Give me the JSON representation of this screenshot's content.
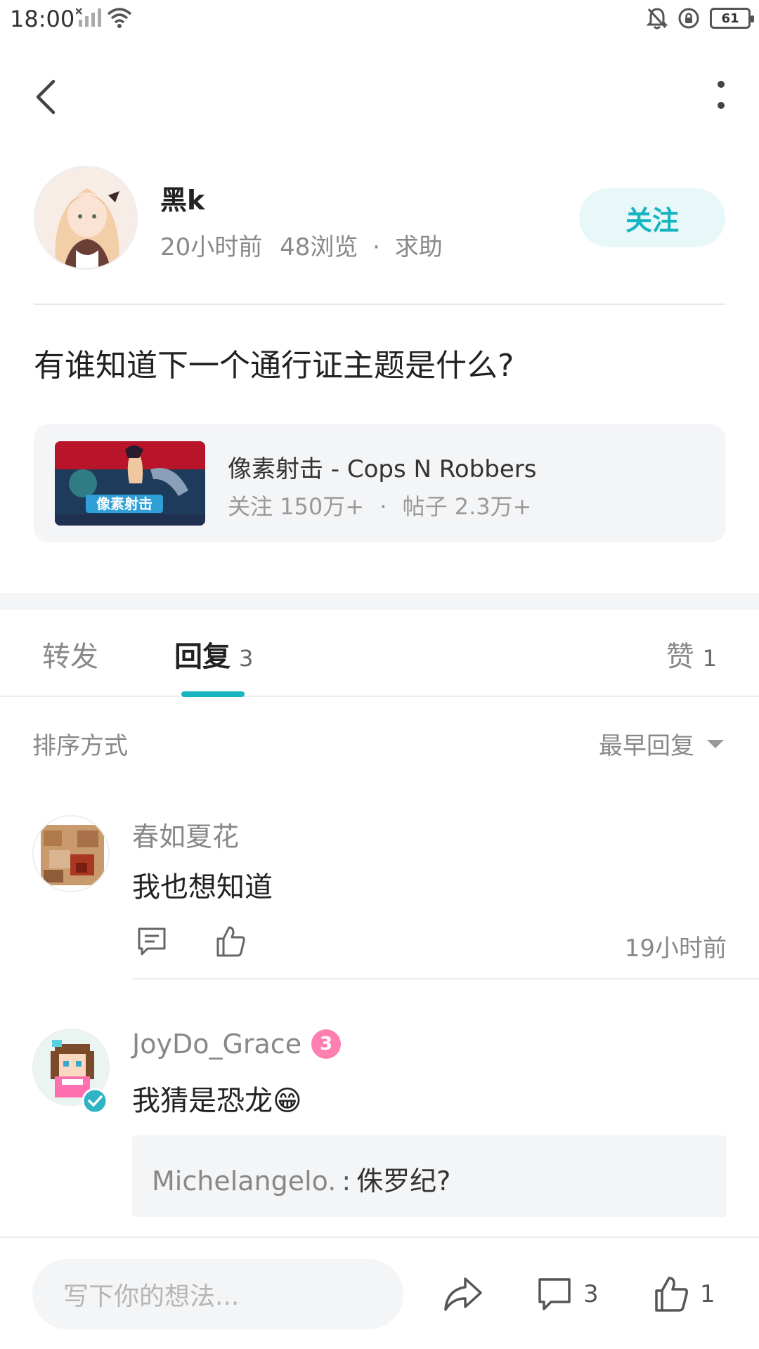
{
  "status_bar": {
    "time": "18:00",
    "battery": "61",
    "icons": [
      "no-signal-icon",
      "wifi-icon",
      "bell-off-icon",
      "rotation-lock-icon",
      "battery-icon"
    ]
  },
  "author": {
    "name": "黑k",
    "time_ago": "20小时前",
    "views": "48浏览",
    "category": "求助",
    "follow_label": "关注"
  },
  "post": {
    "title": "有谁知道下一个通行证主题是什么?"
  },
  "game": {
    "name": "像素射击 - Cops N Robbers",
    "followers": "关注 150万+",
    "posts": "帖子 2.3万+",
    "thumb_text": "像素射击"
  },
  "tabs": {
    "repost": "转发",
    "reply": "回复",
    "reply_count": "3",
    "like": "赞",
    "like_count": "1"
  },
  "sort": {
    "label": "排序方式",
    "value": "最早回复"
  },
  "comments": [
    {
      "user": "春如夏花",
      "text": "我也想知道",
      "time": "19小时前"
    },
    {
      "user": "JoyDo_Grace",
      "level": "3",
      "text": "我猜是恐龙😁",
      "quote_user": "Michelangelo.",
      "quote_sep": ":",
      "quote_text": "侏罗纪?"
    }
  ],
  "bottom_bar": {
    "input_placeholder": "写下你的想法...",
    "comment_count": "3",
    "like_count": "1"
  },
  "colors": {
    "accent": "#17b5c2",
    "follow_bg": "#e8f7f8",
    "card_bg": "#f4f5f7",
    "muted_text": "#888888"
  }
}
